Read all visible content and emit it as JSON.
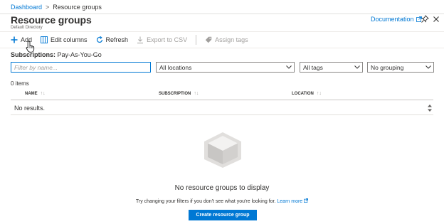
{
  "breadcrumb": {
    "dashboard": "Dashboard",
    "separator": ">",
    "current": "Resource groups"
  },
  "header": {
    "title": "Resource groups",
    "subtitle": "Default Directory",
    "documentation": "Documentation"
  },
  "toolbar": {
    "add": "Add",
    "edit_columns": "Edit columns",
    "refresh": "Refresh",
    "export": "Export to CSV",
    "assign_tags": "Assign tags"
  },
  "subscriptions": {
    "label": "Subscriptions:",
    "value": "Pay-As-You-Go"
  },
  "filters": {
    "name_placeholder": "Filter by name...",
    "locations": "All locations",
    "tags": "All tags",
    "grouping": "No grouping"
  },
  "count": "0 items",
  "grid": {
    "columns": [
      "NAME",
      "SUBSCRIPTION",
      "LOCATION"
    ],
    "empty_row": "No results."
  },
  "empty_state": {
    "title": "No resource groups to display",
    "hint": "Try changing your filters if you don't see what you're looking for.",
    "learn_more": "Learn more",
    "create_button": "Create resource group"
  },
  "colors": {
    "accent": "#0078d4",
    "text": "#323130",
    "muted": "#a19f9d"
  },
  "icons": [
    "plus-icon",
    "columns-icon",
    "refresh-icon",
    "download-icon",
    "tag-icon",
    "external-link-icon",
    "pin-icon",
    "close-icon",
    "chevron-down-icon",
    "sort-icon",
    "cube-icon",
    "hand-cursor-icon"
  ]
}
